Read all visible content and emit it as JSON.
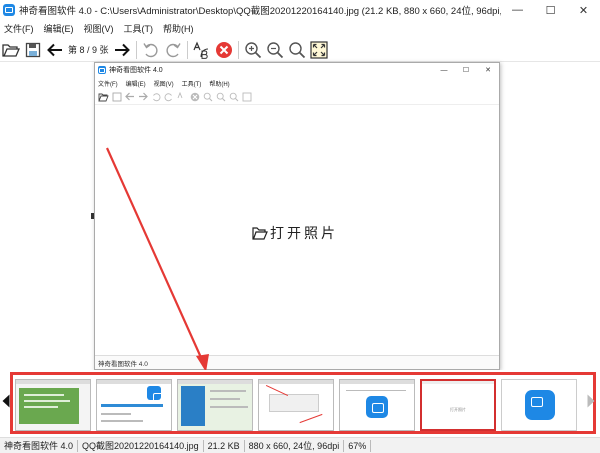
{
  "window": {
    "title": "神奇看图软件 4.0 - C:\\Users\\Administrator\\Desktop\\QQ截图20201220164140.jpg (21.2 KB, 880 x 660, 24位, 96dpi, 67%)",
    "minimize": "—",
    "maximize": "☐",
    "close": "✕"
  },
  "menu": [
    "文件(F)",
    "编辑(E)",
    "视图(V)",
    "工具(T)",
    "帮助(H)"
  ],
  "toolbar": {
    "page_indicator": "第 8 / 9 张"
  },
  "inner_window": {
    "title": "神奇看图软件 4.0",
    "minimize": "—",
    "maximize": "☐",
    "close": "✕",
    "menu": [
      "文件(F)",
      "编辑(E)",
      "视图(V)",
      "工具(T)",
      "帮助(H)"
    ],
    "open_photo": "打开照片",
    "status": "神奇看图软件 4.0"
  },
  "thumbnails": {
    "selected_index": 5,
    "items": [
      {
        "kind": "green-doc"
      },
      {
        "kind": "dialog-progress"
      },
      {
        "kind": "blue-installer"
      },
      {
        "kind": "screenshot-arrows"
      },
      {
        "kind": "app-icon-dialog"
      },
      {
        "kind": "blank-open",
        "caption": "打开照片"
      },
      {
        "kind": "app-icon"
      }
    ]
  },
  "statusbar": {
    "app": "神奇看图软件 4.0",
    "file": "QQ截图20201220164140.jpg",
    "size": "21.2 KB",
    "dims": "880 x 660, 24位, 96dpi",
    "zoom": "67%"
  },
  "colors": {
    "accent_blue": "#1e88e5",
    "highlight_red": "#e53935",
    "delete_red": "#e53935"
  }
}
